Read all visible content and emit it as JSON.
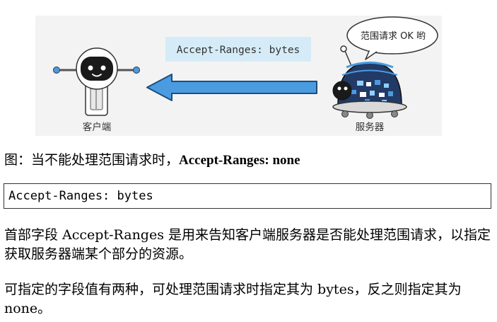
{
  "figure": {
    "header_label": "Accept-Ranges: bytes",
    "speech_bubble": "范围请求 OK 哟",
    "client_label": "客户端",
    "server_label": "服务器"
  },
  "caption": {
    "prefix": "图：当不能处理范围请求时，",
    "bold": "Accept-Ranges: none"
  },
  "code": {
    "text": "Accept-Ranges: bytes"
  },
  "paragraphs": [
    "首部字段 Accept-Ranges 是用来告知客户端服务器是否能处理范围请求，以指定获取服务器端某个部分的资源。",
    "可指定的字段值有两种，可处理范围请求时指定其为 bytes，反之则指定其为 none。"
  ],
  "colors": {
    "arrow_blue": "#4a9be0",
    "header_bg": "#d5ecf8",
    "figure_bg": "#f3f3f3"
  }
}
